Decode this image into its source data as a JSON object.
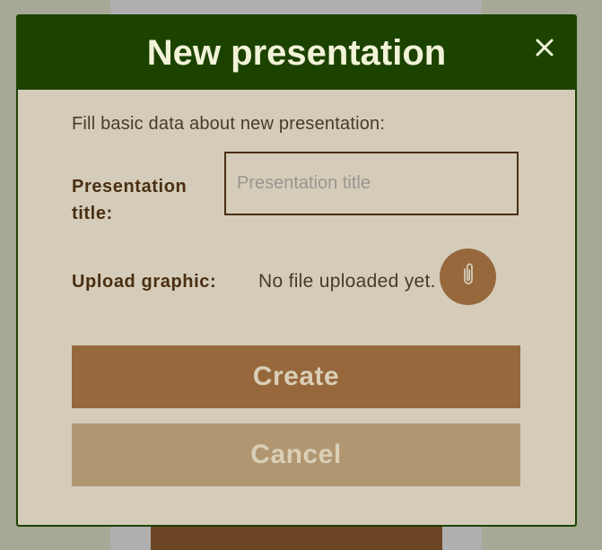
{
  "modal": {
    "title": "New presentation",
    "intro": "Fill basic data about new presentation:",
    "close_icon": "close-icon",
    "colors": {
      "header": "#1c4200",
      "body": "#d4ccb9",
      "primary": "#96683c",
      "secondary": "#b19672",
      "header_text": "#f1f3d8"
    }
  },
  "form": {
    "title_label": "Presentation title:",
    "title_placeholder": "Presentation title",
    "title_value": "",
    "upload_label": "Upload graphic:",
    "upload_status": "No file uploaded yet.",
    "attach_icon": "paperclip-icon"
  },
  "actions": {
    "create_label": "Create",
    "cancel_label": "Cancel"
  }
}
